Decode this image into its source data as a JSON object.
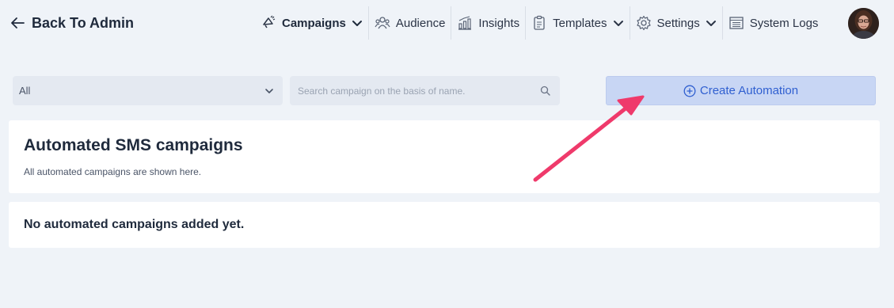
{
  "header": {
    "back_label": "Back To Admin",
    "nav": [
      {
        "label": "Campaigns",
        "icon": "megaphone-icon",
        "dropdown": true,
        "active": true
      },
      {
        "label": "Audience",
        "icon": "users-icon",
        "dropdown": false
      },
      {
        "label": "Insights",
        "icon": "chart-icon",
        "dropdown": false
      },
      {
        "label": "Templates",
        "icon": "clipboard-icon",
        "dropdown": true
      },
      {
        "label": "Settings",
        "icon": "gear-icon",
        "dropdown": true
      },
      {
        "label": "System Logs",
        "icon": "list-icon",
        "dropdown": false
      }
    ]
  },
  "filters": {
    "status_selected": "All",
    "search_placeholder": "Search campaign on the basis of name.",
    "create_label": "Create Automation"
  },
  "main": {
    "title": "Automated SMS campaigns",
    "subtitle": "All automated campaigns are shown here.",
    "empty_message": "No automated campaigns added yet."
  },
  "colors": {
    "background": "#eff3f8",
    "accent": "#2f5fd0",
    "button_bg": "#c8d6f4",
    "annotation_arrow": "#ef3a6b"
  }
}
